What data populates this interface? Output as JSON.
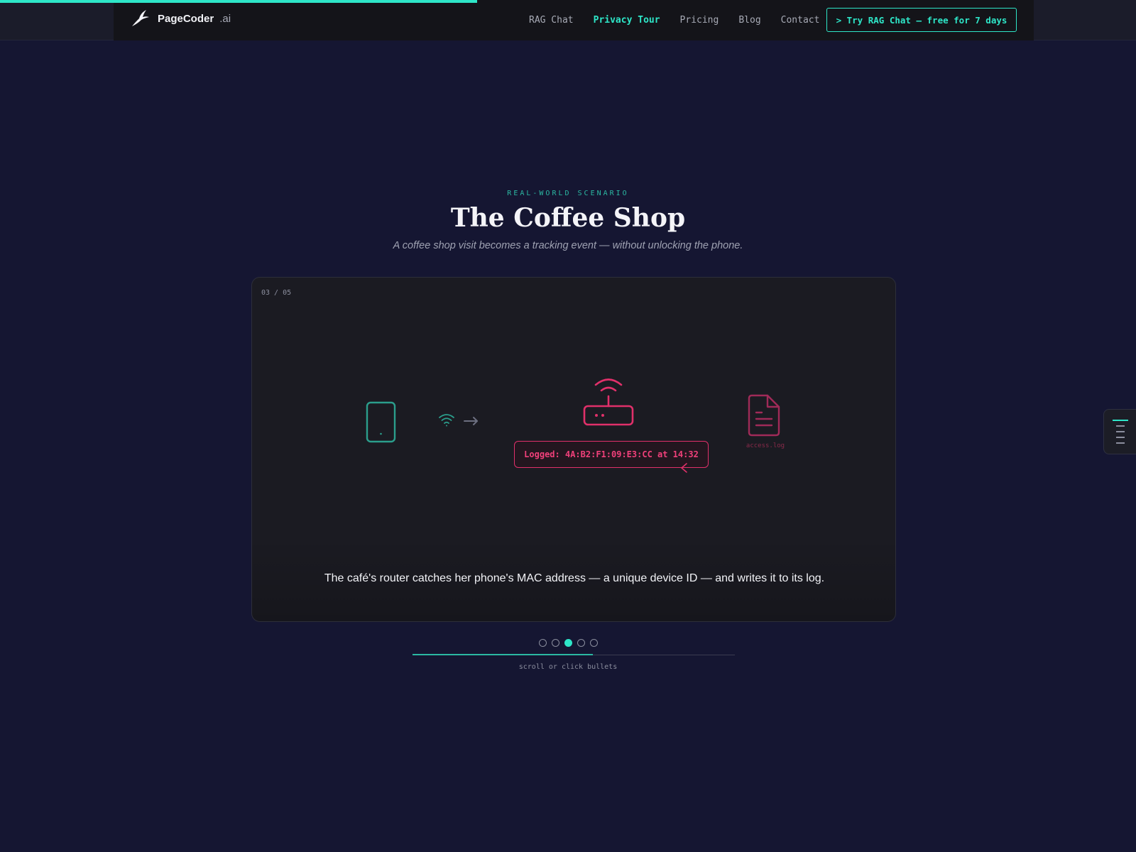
{
  "header": {
    "logo_name": "PageCoder",
    "logo_suffix": ".ai",
    "nav": [
      {
        "label": "RAG Chat",
        "active": false
      },
      {
        "label": "Privacy Tour",
        "active": true
      },
      {
        "label": "Pricing",
        "active": false
      },
      {
        "label": "Blog",
        "active": false
      },
      {
        "label": "Contact",
        "active": false
      }
    ],
    "cta_label": "> Try RAG Chat — free for 7 days"
  },
  "page_progress": 0.42,
  "hero": {
    "eyebrow": "REAL-WORLD SCENARIO",
    "title": "The Coffee Shop",
    "subtitle": "A coffee shop visit becomes a tracking event — without unlocking the phone."
  },
  "slide": {
    "counter": "03 / 05",
    "logged_text": "Logged: 4A:B2:F1:09:E3:CC at 14:32",
    "file_label": "access.log",
    "caption": "The café's router catches her phone's MAC address — a unique device ID — and writes it to its log."
  },
  "stepper": {
    "total": 5,
    "active_index": 2,
    "progress": 0.56,
    "hint": "scroll or click bullets"
  },
  "icons": {
    "phone": "smartphone-icon",
    "wifi": "wifi-icon",
    "arrow": "arrow-right-icon",
    "router": "router-icon",
    "file": "file-text-icon",
    "toc": "list-icon"
  },
  "colors": {
    "accent": "#2ee6c8",
    "alert": "#e0306a",
    "background": "#151632"
  }
}
